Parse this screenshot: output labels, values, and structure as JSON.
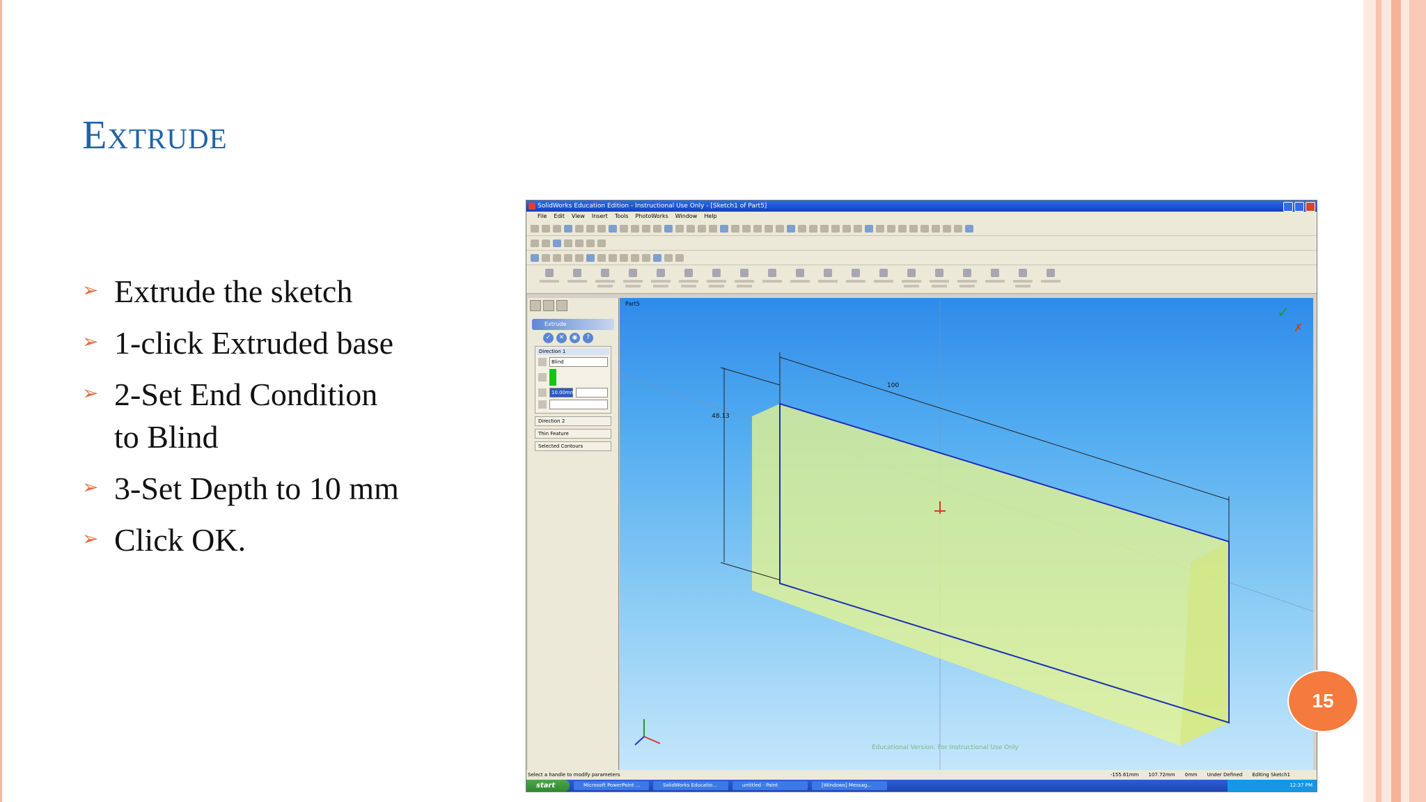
{
  "slide": {
    "title": "Extrude",
    "page_number": "15",
    "bullets": [
      {
        "text": "Extrude the sketch"
      },
      {
        "text": "1-click Extruded base"
      },
      {
        "text": "2-Set End Condition to Blind"
      },
      {
        "text": "3-Set Depth to 10 mm"
      },
      {
        "text": "Click OK."
      }
    ]
  },
  "screenshot": {
    "window_title": "SolidWorks Education Edition - Instructional Use Only - [Sketch1 of Part5]",
    "menu": [
      "File",
      "Edit",
      "View",
      "Insert",
      "Tools",
      "PhotoWorks",
      "Window",
      "Help"
    ],
    "property_manager": {
      "feature_title": "Extrude",
      "direction1_label": "Direction 1",
      "end_condition": "Blind",
      "depth_value": "10.00mm",
      "direction2_label": "Direction 2",
      "thin_feature_label": "Thin Feature",
      "selected_contours_label": "Selected Contours"
    },
    "viewport": {
      "tree_label": "Part5",
      "dim_width": "100",
      "dim_height": "48.13",
      "watermark": "Educational Version. For Instructional Use Only"
    },
    "status_bar": {
      "hint": "Select a handle to modify parameters",
      "x_coord": "-155.61mm",
      "y_coord": "107.72mm",
      "z_coord": "0mm",
      "sketch_state": "Under Defined",
      "mode": "Editing Sketch1"
    },
    "taskbar": {
      "start_label": "start",
      "tasks": [
        "Microsoft PowerPoint ...",
        "SolidWorks Educatio...",
        "untitled - Paint",
        "[Windows] Messag..."
      ],
      "clock": "12:37 PM"
    }
  },
  "colors": {
    "title": "#1f63a8",
    "bullet_arrow": "#e3703e",
    "page_badge": "#f47a3e",
    "solid_fill": "#e6f38e",
    "sketch_line": "#1d2fb5"
  }
}
